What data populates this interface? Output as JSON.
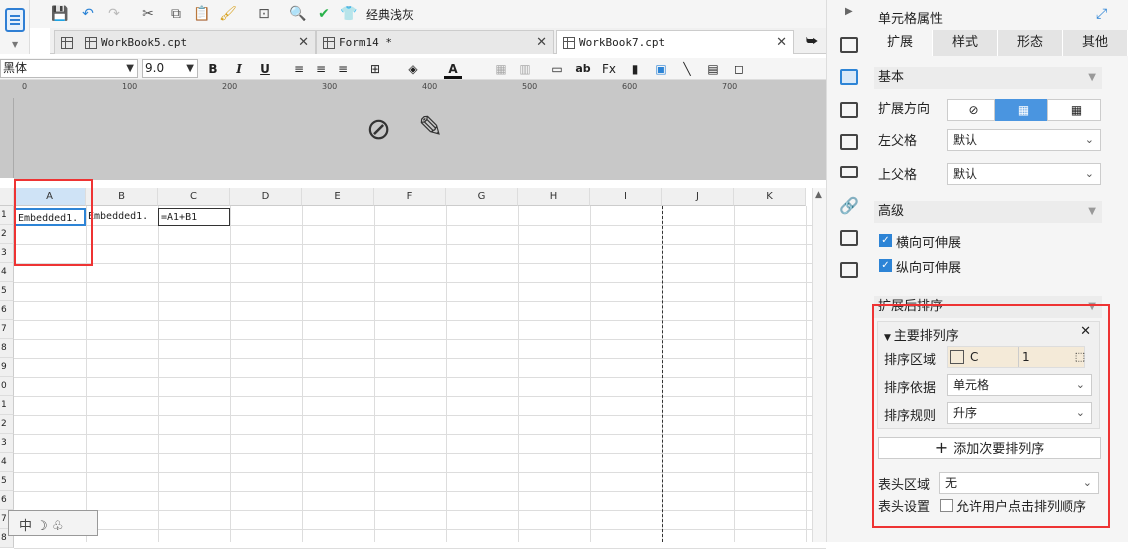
{
  "toolbar": {
    "theme_label": "经典浅灰"
  },
  "tabs": [
    {
      "label": "WorkBook5.cpt"
    },
    {
      "label": "Form14 *"
    },
    {
      "label": "WorkBook7.cpt"
    }
  ],
  "format_bar": {
    "font": "黑体",
    "size": "9.0"
  },
  "ruler": {
    "ticks": [
      "0",
      "100",
      "200",
      "300",
      "400",
      "500",
      "600",
      "700"
    ]
  },
  "grid": {
    "columns": [
      "A",
      "B",
      "C",
      "D",
      "E",
      "F",
      "G",
      "H",
      "I",
      "J",
      "K"
    ],
    "rows": [
      "1",
      "2",
      "3",
      "4",
      "5",
      "6",
      "7",
      "8",
      "9",
      "0",
      "1",
      "2",
      "3",
      "4",
      "5",
      "6",
      "7",
      "8"
    ],
    "cells": {
      "A1": "Embedded1.",
      "B1": "Embedded1.",
      "C1": "=A1+B1"
    }
  },
  "ime": {
    "label": "中 ☽ ♧"
  },
  "panel": {
    "title": "单元格属性",
    "tabs": [
      "扩展",
      "样式",
      "形态",
      "其他"
    ],
    "basic": {
      "title": "基本",
      "expand_dir": "扩展方向",
      "left_parent": "左父格",
      "left_parent_value": "默认",
      "up_parent": "上父格",
      "up_parent_value": "默认"
    },
    "advanced": {
      "title": "高级",
      "h_expand": "横向可伸展",
      "v_expand": "纵向可伸展"
    },
    "sort": {
      "title": "扩展后排序",
      "primary": "主要排列序",
      "area_label": "排序区域",
      "area_col": "C",
      "area_row": "1",
      "basis_label": "排序依据",
      "basis_value": "单元格",
      "rule_label": "排序规则",
      "rule_value": "升序",
      "add_secondary": "添加次要排列序",
      "header_area_label": "表头区域",
      "header_area_value": "无",
      "header_setting_label": "表头设置",
      "header_setting_value": "允许用户点击排列顺序"
    }
  },
  "colors": {
    "accent": "#2d84d6",
    "highlight_red": "#e33333"
  }
}
